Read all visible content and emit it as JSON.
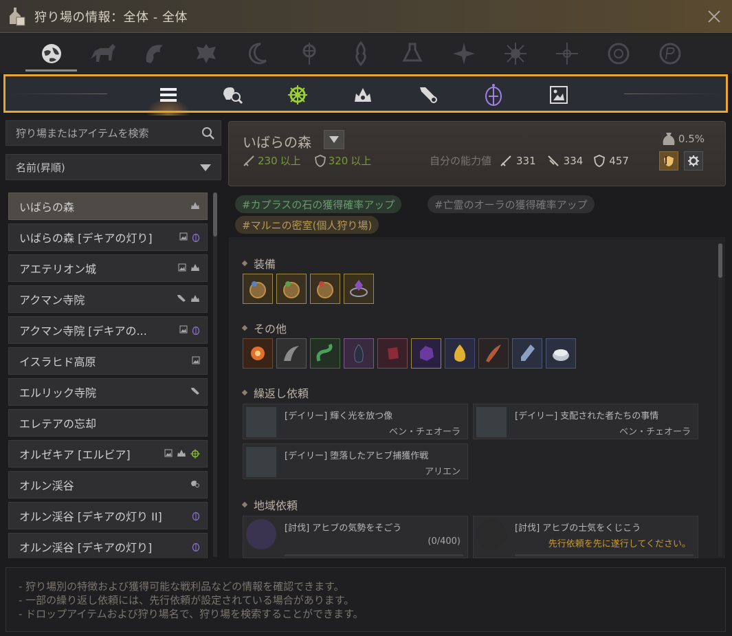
{
  "window": {
    "title": "狩り場の情報：全体 - 全体"
  },
  "category_tabs": [
    {
      "icon": "globe-icon",
      "active": true
    },
    {
      "icon": "horse-icon"
    },
    {
      "icon": "dragon-icon"
    },
    {
      "icon": "eagle-crest-icon"
    },
    {
      "icon": "crescent-icon"
    },
    {
      "icon": "diamond-emblem-icon"
    },
    {
      "icon": "flame-emblem-icon"
    },
    {
      "icon": "flask-emblem-icon"
    },
    {
      "icon": "star-burst-icon"
    },
    {
      "icon": "sun-emblem-icon"
    },
    {
      "icon": "compass-star-icon"
    },
    {
      "icon": "wreath-emblem-icon"
    },
    {
      "icon": "rune-emblem-icon"
    }
  ],
  "filter_icons": [
    {
      "icon": "list-icon",
      "active": true
    },
    {
      "icon": "search-monster-icon"
    },
    {
      "icon": "green-gear-icon"
    },
    {
      "icon": "crown-icon"
    },
    {
      "icon": "scroll-icon"
    },
    {
      "icon": "purple-lantern-icon"
    },
    {
      "icon": "portrait-icon"
    }
  ],
  "search": {
    "placeholder": "狩り場またはアイテムを検索"
  },
  "sort": {
    "label": "名前(昇順)"
  },
  "zones": [
    {
      "name": "いばらの森",
      "icons": [
        "crown"
      ],
      "selected": true
    },
    {
      "name": "いばらの森 [デキアの灯り]",
      "icons": [
        "portrait",
        "lantern"
      ]
    },
    {
      "name": "アエテリオン城",
      "icons": [
        "portrait",
        "crown"
      ]
    },
    {
      "name": "アクマン寺院",
      "icons": [
        "scroll",
        "crown"
      ]
    },
    {
      "name": "アクマン寺院 [デキアの...",
      "icons": [
        "portrait",
        "lantern"
      ]
    },
    {
      "name": "イスラヒド高原",
      "icons": [
        "portrait"
      ]
    },
    {
      "name": "エルリック寺院",
      "icons": [
        "scroll"
      ]
    },
    {
      "name": "エレテアの忘却",
      "icons": []
    },
    {
      "name": "オルゼキア [エルビア]",
      "icons": [
        "portrait",
        "crown",
        "gear"
      ]
    },
    {
      "name": "オルン渓谷",
      "icons": [
        "search"
      ]
    },
    {
      "name": "オルン渓谷 [デキアの灯り II]",
      "icons": [
        "lantern"
      ]
    },
    {
      "name": "オルン渓谷 [デキアの灯り]",
      "icons": [
        "lantern"
      ]
    }
  ],
  "zone_header": {
    "name": "いばらの森",
    "drop_rate": "0.5%",
    "req_ap": "230",
    "req_ap_suffix": "以上",
    "req_dp": "320",
    "req_dp_suffix": "以上",
    "my_stats_label": "自分の能力値",
    "my_ap": "331",
    "my_aap": "334",
    "my_dp": "457"
  },
  "tags": [
    "#カプラスの石の獲得確率アップ",
    "#亡霊のオーラの獲得確率アップ",
    "#マルニの密室(個人狩り場)"
  ],
  "sections": {
    "equipment": "装備",
    "other": "その他",
    "repeat_quests": "繰返し依頼",
    "region_quests": "地域依頼"
  },
  "repeat_quests": [
    {
      "title": "[デイリー] 輝く光を放つ像",
      "npc": "ベン・チェオーラ"
    },
    {
      "title": "[デイリー] 支配された者たちの事情",
      "npc": "ベン・チェオーラ"
    },
    {
      "title": "[デイリー] 堕落したアヒブ捕獲作戦",
      "npc": "アリエン"
    }
  ],
  "region_quests": [
    {
      "title": "[討伐] アヒブの気勢をそごう",
      "progress": "(0/400)"
    },
    {
      "title": "[討伐] アヒブの士気をくじこう",
      "warning": "先行依頼を先に遂行してください。"
    }
  ],
  "footer": [
    "- 狩り場別の特徴および獲得可能な戦利品などの情報を確認できます。",
    "- 一部の繰り返し依頼には、先行依頼が設定されている場合があります。",
    "- ドロップアイテムおよび狩り場名で、狩り場を検索することができます。"
  ]
}
